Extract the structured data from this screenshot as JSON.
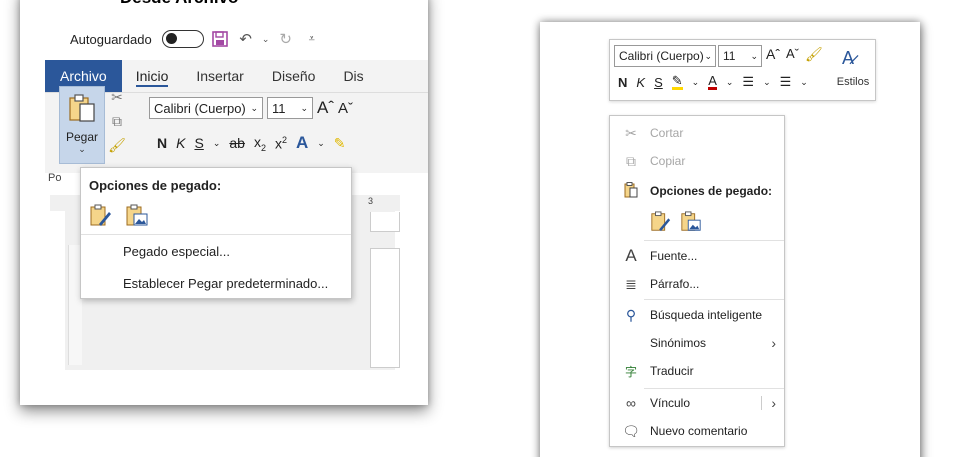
{
  "left": {
    "title": "Desde Archivo",
    "qat": {
      "autosave_label": "Autoguardado"
    },
    "tabs": [
      "Archivo",
      "Inicio",
      "Insertar",
      "Diseño",
      "Dis"
    ],
    "ribbon": {
      "paste_label": "Pegar",
      "font_name": "Calibri (Cuerpo)",
      "font_size": "11",
      "group_label": "Po",
      "ruler_mark": "3"
    },
    "paste_menu": {
      "header": "Opciones de pegado:",
      "items": [
        "Pegado especial...",
        "Establecer Pegar predeterminado..."
      ]
    }
  },
  "right": {
    "mini_toolbar": {
      "font_name": "Calibri (Cuerpo)",
      "font_size": "11",
      "styles_label": "Estilos"
    },
    "context_menu": {
      "items": [
        {
          "label": "Cortar",
          "icon": "scissors-icon",
          "disabled": true
        },
        {
          "label": "Copiar",
          "icon": "copy-icon",
          "disabled": true
        },
        {
          "label": "Opciones de pegado:",
          "icon": "clipboard-icon",
          "bold": true
        },
        {
          "label": "Fuente...",
          "icon": "font-icon"
        },
        {
          "label": "Párrafo...",
          "icon": "paragraph-icon"
        },
        {
          "label": "Búsqueda inteligente",
          "icon": "smart-lookup-icon"
        },
        {
          "label": "Sinónimos",
          "icon": "",
          "submenu": true
        },
        {
          "label": "Traducir",
          "icon": "translate-icon"
        },
        {
          "label": "Vínculo",
          "icon": "link-icon",
          "submenu": true
        },
        {
          "label": "Nuevo comentario",
          "icon": "comment-icon"
        }
      ]
    }
  },
  "colors": {
    "accent": "#2b579a",
    "paste_highlight": "#c6d6ea",
    "save_icon": "#a349a4",
    "highlight_yellow": "#ffd800",
    "font_red": "#c00000"
  }
}
